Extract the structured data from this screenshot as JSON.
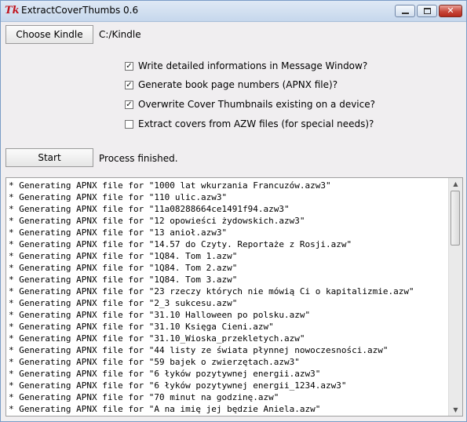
{
  "window": {
    "title": "ExtractCoverThumbs 0.6",
    "app_icon": "tk-feather-icon",
    "close_glyph": "✕"
  },
  "top": {
    "choose_button": "Choose Kindle",
    "path": "C:/Kindle"
  },
  "options": [
    {
      "label": "Write detailed informations in Message Window?",
      "checked": true,
      "mark": "✓"
    },
    {
      "label": "Generate book page numbers (APNX file)?",
      "checked": true,
      "mark": "✓"
    },
    {
      "label": "Overwrite Cover Thumbnails existing on a device?",
      "checked": true,
      "mark": "✓"
    },
    {
      "label": "Extract covers from AZW files (for special needs)?",
      "checked": false,
      "mark": ""
    }
  ],
  "action": {
    "start_button": "Start",
    "status": "Process finished."
  },
  "log": {
    "lines": [
      "* Generating APNX file for \"1000 lat wkurzania Francuzów.azw3\"",
      "* Generating APNX file for \"110 ulic.azw3\"",
      "* Generating APNX file for \"11a08288664ce1491f94.azw3\"",
      "* Generating APNX file for \"12 opowieści żydowskich.azw3\"",
      "* Generating APNX file for \"13 anioł.azw3\"",
      "* Generating APNX file for \"14.57 do Czyty. Reportaże z Rosji.azw\"",
      "* Generating APNX file for \"1Q84. Tom 1.azw\"",
      "* Generating APNX file for \"1Q84. Tom 2.azw\"",
      "* Generating APNX file for \"1Q84. Tom 3.azw\"",
      "* Generating APNX file for \"23 rzeczy których nie mówią Ci o kapitalizmie.azw\"",
      "* Generating APNX file for \"2_3 sukcesu.azw\"",
      "* Generating APNX file for \"31.10 Halloween po polsku.azw\"",
      "* Generating APNX file for \"31.10 Księga Cieni.azw\"",
      "* Generating APNX file for \"31.10_Wioska_przekletych.azw\"",
      "* Generating APNX file for \"44 listy ze świata płynnej nowoczesności.azw\"",
      "* Generating APNX file for \"59 bajek o zwierzętach.azw3\"",
      "* Generating APNX file for \"6 łyków pozytywnej energii.azw3\"",
      "* Generating APNX file for \"6 łyków pozytywnej energii_1234.azw3\"",
      "* Generating APNX file for \"70 minut na godzinę.azw\"",
      "* Generating APNX file for \"A na imię jej będzie Aniela.azw\""
    ]
  },
  "scrollbar": {
    "up_glyph": "▲",
    "down_glyph": "▼"
  }
}
